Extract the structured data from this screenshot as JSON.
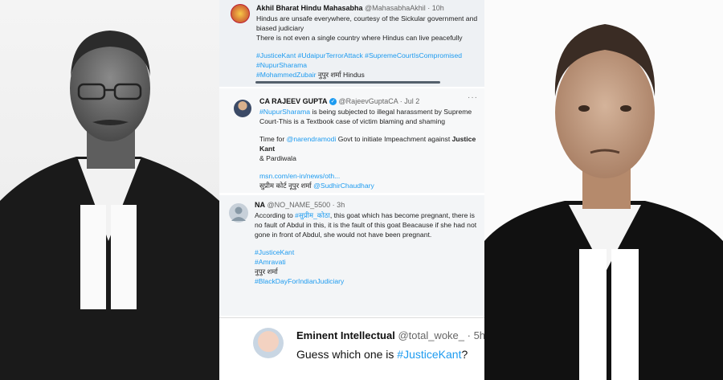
{
  "tweets": [
    {
      "name": "Akhil Bharat Hindu Mahasabha",
      "handle": "@MahasabhaAkhil",
      "time": "· 10h",
      "lines": [
        "Hindus are unsafe everywhere, courtesy of the Sickular government and",
        "biased judiciary",
        "There is not even a single country where Hindus can live peacefully"
      ],
      "hashtags_line1": "#JusticeKant #UdaipurTerrorAttack #SupremeCourtIsCompromised",
      "hashtags_line2": "#NupurSharama",
      "hashtags_line3": "#MohammedZubair",
      "tail": " नुपुर शर्मा Hindus"
    },
    {
      "name": "CA RAJEEV GUPTA",
      "handle": "@RajeevGuptaCA · Jul 2",
      "menu": "···",
      "line1_tag": "#NupurSharama",
      "line1_text": " is being subjected to illegal harassment by Supreme",
      "line2": "Court-This is a Textbook case of victim blaming and shaming",
      "line3_pre": "Time for ",
      "line3_mention": "@narendramodi",
      "line3_post": " Govt to initiate Impeachment against ",
      "line3_bold": "Justice Kant",
      "line4_pre": "& Pardiwala",
      "link": "msn.com/en-in/news/oth...",
      "line6_text": "सुप्रीम कोर्ट नूपुर शर्मा ",
      "line6_mention": "@SudhirChaudhary"
    },
    {
      "name": "NA",
      "handle": "@NO_NAME_5500 · 3h",
      "line1_pre": "According to ",
      "line1_tag": "#सुप्रीम_कोठा",
      "line1_post": ", this goat which has become pregnant, there is",
      "line2": "no fault of Abdul in this, it is the fault of this goat Beacause if she had not",
      "line3": "gone in front of Abdul, she would not have been pregnant.",
      "tag1": "#JusticeKant",
      "tag2": "#Amravati",
      "plain": "नुपुर शर्मा",
      "tag3": "#BlackDayForIndianJudiciary"
    },
    {
      "name": "Eminent Intellectual",
      "handle": "@total_woke_ · 5h",
      "text_pre": "Guess which one is ",
      "text_tag": "#JusticeKant",
      "text_post": "?"
    }
  ]
}
